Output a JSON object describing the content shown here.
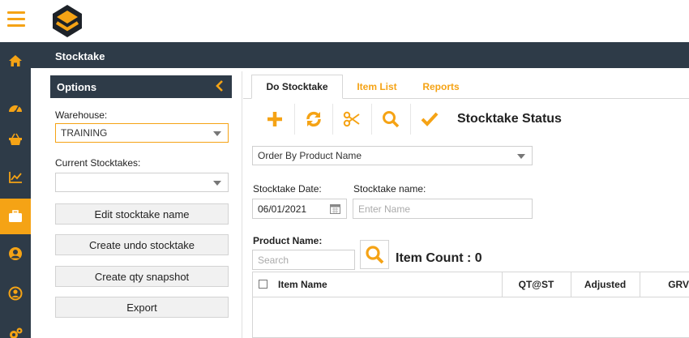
{
  "app": {
    "page_title": "Stocktake"
  },
  "colors": {
    "accent": "#f5a315",
    "dark": "#2e3b48"
  },
  "rail": {
    "icons": [
      "home-icon",
      "dashboard-icon",
      "basket-icon",
      "chart-icon",
      "briefcase-icon",
      "user-circle-icon",
      "account-icon",
      "gears-icon"
    ],
    "active_index": 4
  },
  "options": {
    "title": "Options",
    "warehouse_label": "Warehouse:",
    "warehouse_value": "TRAINING",
    "current_label": "Current Stocktakes:",
    "current_value": "",
    "buttons": {
      "edit": "Edit stocktake name",
      "undo": "Create undo stocktake",
      "snapshot": "Create qty snapshot",
      "export": "Export"
    }
  },
  "tabs": {
    "do": "Do Stocktake",
    "items": "Item List",
    "reports": "Reports"
  },
  "toolbar": {
    "status_title": "Stocktake Status"
  },
  "form": {
    "order_by": "Order By Product Name",
    "date_label": "Stocktake Date:",
    "date_value": "06/01/2021",
    "name_label": "Stocktake name:",
    "name_placeholder": "Enter Name",
    "product_label": "Product Name:",
    "search_placeholder": "Search",
    "item_count": "Item Count : 0"
  },
  "grid": {
    "columns": [
      "Item Name",
      "QT@ST",
      "Adjusted",
      "GRV"
    ]
  }
}
